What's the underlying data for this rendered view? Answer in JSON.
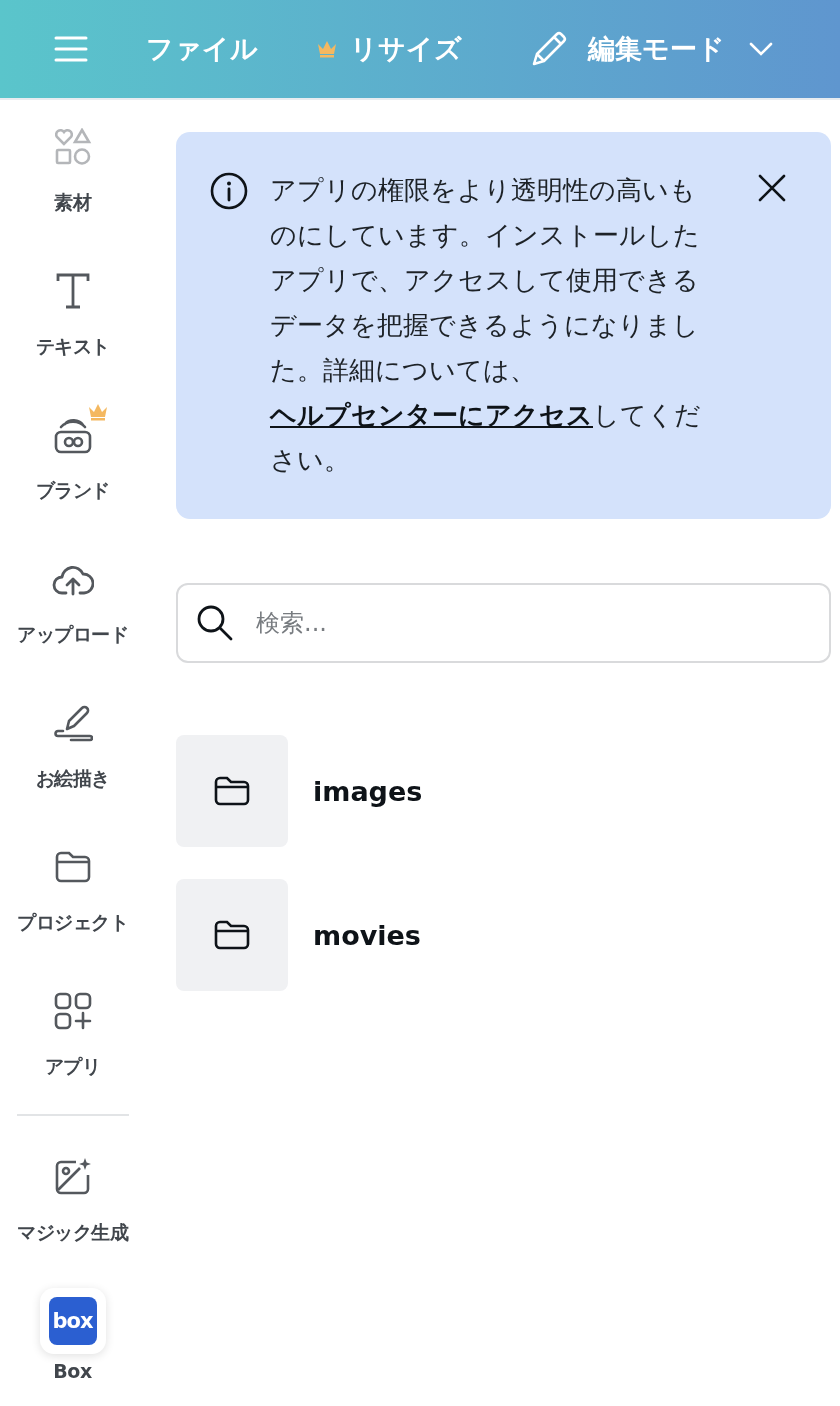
{
  "header": {
    "file_label": "ファイル",
    "resize_label": "リサイズ",
    "resize_premium": true,
    "mode_label": "編集モード"
  },
  "sidebar": {
    "items": [
      {
        "kind": "elements",
        "label": "素材",
        "premium": false,
        "faded": true
      },
      {
        "kind": "text",
        "label": "テキスト",
        "premium": false,
        "faded": false
      },
      {
        "kind": "brand",
        "label": "ブランド",
        "premium": true,
        "faded": false
      },
      {
        "kind": "upload",
        "label": "アップロード",
        "premium": false,
        "faded": false
      },
      {
        "kind": "draw",
        "label": "お絵描き",
        "premium": false,
        "faded": false
      },
      {
        "kind": "projects",
        "label": "プロジェクト",
        "premium": false,
        "faded": false
      },
      {
        "kind": "apps",
        "label": "アプリ",
        "premium": false,
        "faded": false
      }
    ],
    "extra_items": [
      {
        "kind": "magic",
        "label": "マジック生成"
      },
      {
        "kind": "box",
        "label": "Box",
        "logo_text": "box"
      }
    ]
  },
  "notice": {
    "text_before": "アプリの権限をより透明性の高いものにしています。インストールしたアプリで、アクセスして使用できるデータを把握できるようになりました。詳細については、",
    "link": "ヘルプセンターにアクセス",
    "text_after": "してください。"
  },
  "search": {
    "placeholder": "検索..."
  },
  "folders": [
    {
      "name": "images"
    },
    {
      "name": "movies"
    }
  ]
}
